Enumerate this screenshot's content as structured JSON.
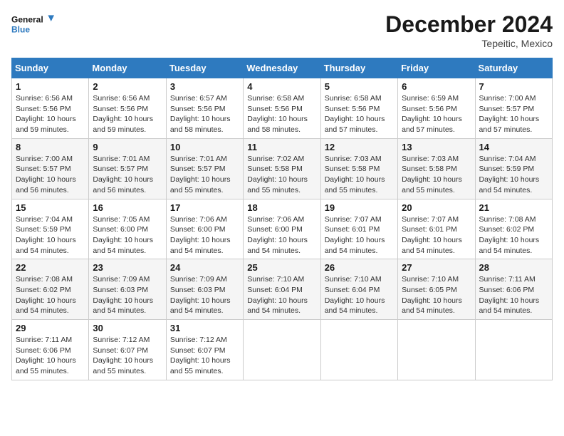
{
  "logo": {
    "line1": "General",
    "line2": "Blue"
  },
  "title": "December 2024",
  "location": "Tepeitic, Mexico",
  "days_header": [
    "Sunday",
    "Monday",
    "Tuesday",
    "Wednesday",
    "Thursday",
    "Friday",
    "Saturday"
  ],
  "weeks": [
    [
      {
        "day": "1",
        "info": "Sunrise: 6:56 AM\nSunset: 5:56 PM\nDaylight: 10 hours\nand 59 minutes."
      },
      {
        "day": "2",
        "info": "Sunrise: 6:56 AM\nSunset: 5:56 PM\nDaylight: 10 hours\nand 59 minutes."
      },
      {
        "day": "3",
        "info": "Sunrise: 6:57 AM\nSunset: 5:56 PM\nDaylight: 10 hours\nand 58 minutes."
      },
      {
        "day": "4",
        "info": "Sunrise: 6:58 AM\nSunset: 5:56 PM\nDaylight: 10 hours\nand 58 minutes."
      },
      {
        "day": "5",
        "info": "Sunrise: 6:58 AM\nSunset: 5:56 PM\nDaylight: 10 hours\nand 57 minutes."
      },
      {
        "day": "6",
        "info": "Sunrise: 6:59 AM\nSunset: 5:56 PM\nDaylight: 10 hours\nand 57 minutes."
      },
      {
        "day": "7",
        "info": "Sunrise: 7:00 AM\nSunset: 5:57 PM\nDaylight: 10 hours\nand 57 minutes."
      }
    ],
    [
      {
        "day": "8",
        "info": "Sunrise: 7:00 AM\nSunset: 5:57 PM\nDaylight: 10 hours\nand 56 minutes."
      },
      {
        "day": "9",
        "info": "Sunrise: 7:01 AM\nSunset: 5:57 PM\nDaylight: 10 hours\nand 56 minutes."
      },
      {
        "day": "10",
        "info": "Sunrise: 7:01 AM\nSunset: 5:57 PM\nDaylight: 10 hours\nand 55 minutes."
      },
      {
        "day": "11",
        "info": "Sunrise: 7:02 AM\nSunset: 5:58 PM\nDaylight: 10 hours\nand 55 minutes."
      },
      {
        "day": "12",
        "info": "Sunrise: 7:03 AM\nSunset: 5:58 PM\nDaylight: 10 hours\nand 55 minutes."
      },
      {
        "day": "13",
        "info": "Sunrise: 7:03 AM\nSunset: 5:58 PM\nDaylight: 10 hours\nand 55 minutes."
      },
      {
        "day": "14",
        "info": "Sunrise: 7:04 AM\nSunset: 5:59 PM\nDaylight: 10 hours\nand 54 minutes."
      }
    ],
    [
      {
        "day": "15",
        "info": "Sunrise: 7:04 AM\nSunset: 5:59 PM\nDaylight: 10 hours\nand 54 minutes."
      },
      {
        "day": "16",
        "info": "Sunrise: 7:05 AM\nSunset: 6:00 PM\nDaylight: 10 hours\nand 54 minutes."
      },
      {
        "day": "17",
        "info": "Sunrise: 7:06 AM\nSunset: 6:00 PM\nDaylight: 10 hours\nand 54 minutes."
      },
      {
        "day": "18",
        "info": "Sunrise: 7:06 AM\nSunset: 6:00 PM\nDaylight: 10 hours\nand 54 minutes."
      },
      {
        "day": "19",
        "info": "Sunrise: 7:07 AM\nSunset: 6:01 PM\nDaylight: 10 hours\nand 54 minutes."
      },
      {
        "day": "20",
        "info": "Sunrise: 7:07 AM\nSunset: 6:01 PM\nDaylight: 10 hours\nand 54 minutes."
      },
      {
        "day": "21",
        "info": "Sunrise: 7:08 AM\nSunset: 6:02 PM\nDaylight: 10 hours\nand 54 minutes."
      }
    ],
    [
      {
        "day": "22",
        "info": "Sunrise: 7:08 AM\nSunset: 6:02 PM\nDaylight: 10 hours\nand 54 minutes."
      },
      {
        "day": "23",
        "info": "Sunrise: 7:09 AM\nSunset: 6:03 PM\nDaylight: 10 hours\nand 54 minutes."
      },
      {
        "day": "24",
        "info": "Sunrise: 7:09 AM\nSunset: 6:03 PM\nDaylight: 10 hours\nand 54 minutes."
      },
      {
        "day": "25",
        "info": "Sunrise: 7:10 AM\nSunset: 6:04 PM\nDaylight: 10 hours\nand 54 minutes."
      },
      {
        "day": "26",
        "info": "Sunrise: 7:10 AM\nSunset: 6:04 PM\nDaylight: 10 hours\nand 54 minutes."
      },
      {
        "day": "27",
        "info": "Sunrise: 7:10 AM\nSunset: 6:05 PM\nDaylight: 10 hours\nand 54 minutes."
      },
      {
        "day": "28",
        "info": "Sunrise: 7:11 AM\nSunset: 6:06 PM\nDaylight: 10 hours\nand 54 minutes."
      }
    ],
    [
      {
        "day": "29",
        "info": "Sunrise: 7:11 AM\nSunset: 6:06 PM\nDaylight: 10 hours\nand 55 minutes."
      },
      {
        "day": "30",
        "info": "Sunrise: 7:12 AM\nSunset: 6:07 PM\nDaylight: 10 hours\nand 55 minutes."
      },
      {
        "day": "31",
        "info": "Sunrise: 7:12 AM\nSunset: 6:07 PM\nDaylight: 10 hours\nand 55 minutes."
      },
      null,
      null,
      null,
      null
    ]
  ]
}
